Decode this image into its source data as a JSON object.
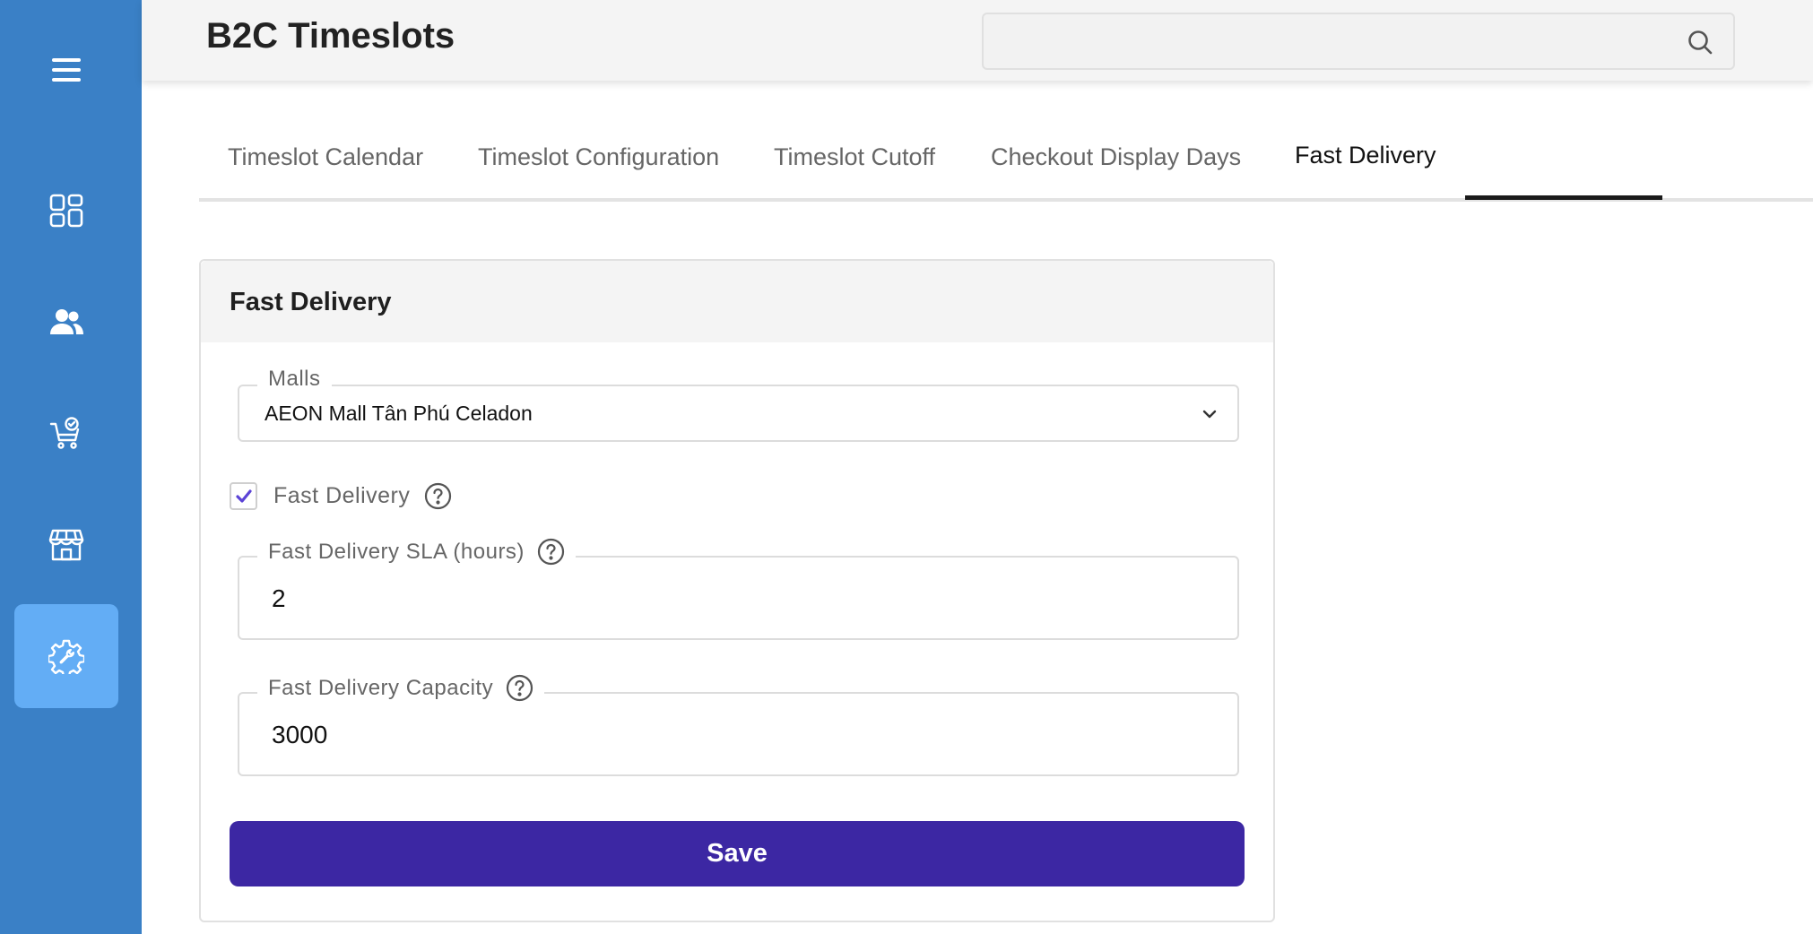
{
  "app": {
    "title": "B2C Timeslots"
  },
  "colors": {
    "sidebar_bg": "#3a80c6",
    "sidebar_active": "#63adf5",
    "primary_button": "#3c27a3",
    "checkbox_mark": "#5b43d6"
  },
  "sidebar": {
    "items": [
      {
        "icon": "menu-icon",
        "active": false
      },
      {
        "icon": "dashboard-icon",
        "active": false
      },
      {
        "icon": "users-icon",
        "active": false
      },
      {
        "icon": "cart-check-icon",
        "active": false
      },
      {
        "icon": "store-icon",
        "active": false
      },
      {
        "icon": "settings-icon",
        "active": true
      }
    ]
  },
  "search": {
    "value": "",
    "icon": "search-icon"
  },
  "tabs": [
    {
      "label": "Timeslot Calendar",
      "active": false
    },
    {
      "label": "Timeslot Configuration",
      "active": false
    },
    {
      "label": "Timeslot Cutoff",
      "active": false
    },
    {
      "label": "Checkout Display Days",
      "active": false
    },
    {
      "label": "Fast Delivery",
      "active": true
    }
  ],
  "card": {
    "title": "Fast Delivery",
    "malls": {
      "label": "Malls",
      "value": "AEON Mall Tân Phú Celadon"
    },
    "fast_delivery": {
      "label": "Fast Delivery",
      "checked": true
    },
    "sla": {
      "label": "Fast Delivery SLA (hours)",
      "value": "2"
    },
    "capacity": {
      "label": "Fast Delivery Capacity",
      "value": "3000"
    },
    "save_label": "Save"
  }
}
